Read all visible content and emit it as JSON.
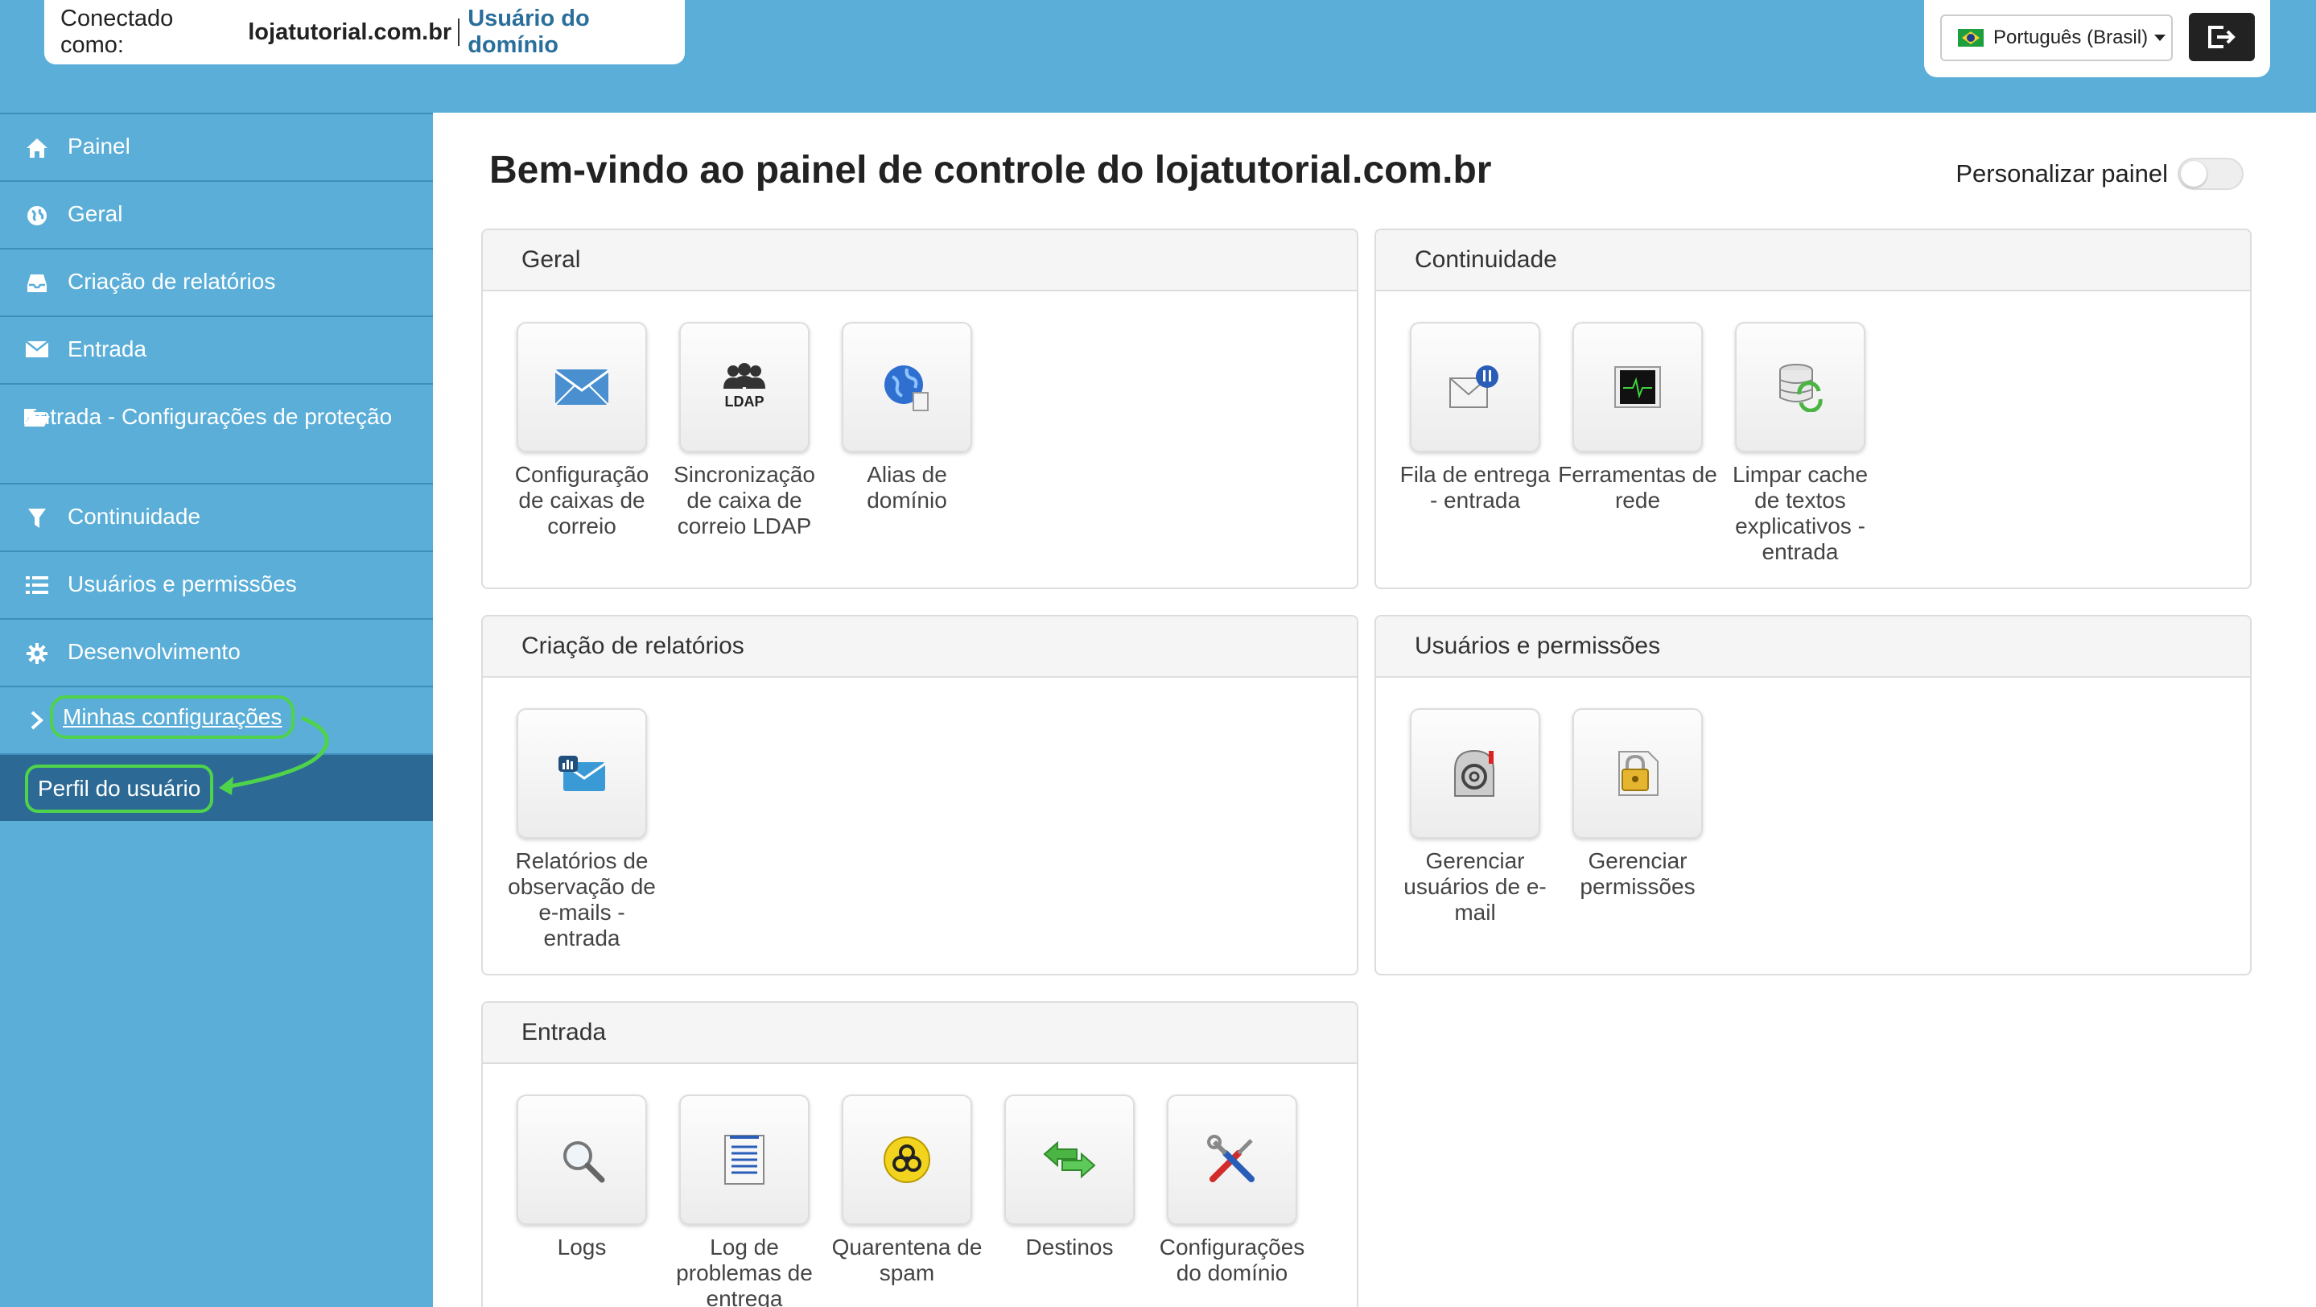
{
  "header": {
    "connected_label": "Conectado como:",
    "domain": "lojatutorial.com.br",
    "role": "Usuário do domínio",
    "language": "Português (Brasil)"
  },
  "sidebar": {
    "items": [
      {
        "label": "Painel",
        "icon": "home-icon"
      },
      {
        "label": "Geral",
        "icon": "globe-icon"
      },
      {
        "label": "Criação de relatórios",
        "icon": "inbox-icon"
      },
      {
        "label": "Entrada",
        "icon": "envelope-icon"
      },
      {
        "label": "Entrada - Configurações de proteção",
        "icon": "folder-open-icon"
      },
      {
        "label": "Continuidade",
        "icon": "filter-icon"
      },
      {
        "label": "Usuários e permissões",
        "icon": "list-icon"
      },
      {
        "label": "Desenvolvimento",
        "icon": "gear-icon"
      }
    ],
    "my_settings": "Minhas configurações",
    "user_profile": "Perfil do usuário"
  },
  "main": {
    "title": "Bem-vindo ao painel de controle do lojatutorial.com.br",
    "customize_label": "Personalizar painel",
    "customize_on": false,
    "panels": {
      "geral": {
        "title": "Geral",
        "tiles": [
          "Configuração de caixas de correio",
          "Sincronização de caixa de correio LDAP",
          "Alias de domínio"
        ]
      },
      "continuidade": {
        "title": "Continuidade",
        "tiles": [
          "Fila de entrega - entrada",
          "Ferramentas de rede",
          "Limpar cache de textos explicativos - entrada"
        ]
      },
      "relatorios": {
        "title": "Criação de relatórios",
        "tiles": [
          "Relatórios de observação de e-mails - entrada"
        ]
      },
      "usuarios": {
        "title": "Usuários e permissões",
        "tiles": [
          "Gerenciar usuários de e-mail",
          "Gerenciar permissões"
        ]
      },
      "entrada": {
        "title": "Entrada",
        "tiles": [
          "Logs",
          "Log de problemas de entrega",
          "Quarentena de spam",
          "Destinos",
          "Configurações do domínio"
        ]
      }
    },
    "ldap_icon_text": "LDAP"
  },
  "colors": {
    "sidebar_bg": "#5aaed8",
    "sidebar_active": "#2c6a95",
    "highlight": "#4fd34a",
    "role_link": "#2a6f9c"
  }
}
